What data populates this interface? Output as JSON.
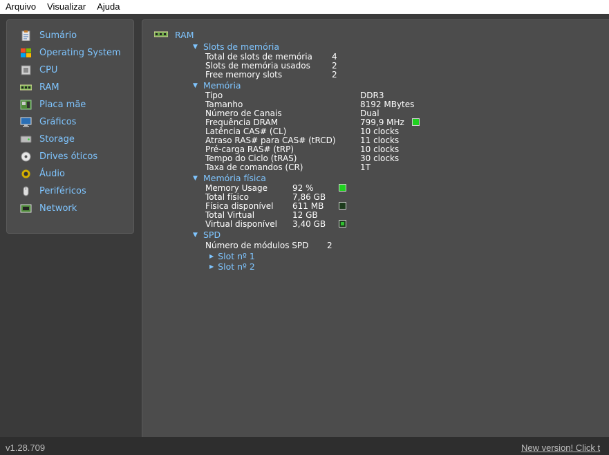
{
  "menu": [
    "Arquivo",
    "Visualizar",
    "Ajuda"
  ],
  "sidebar": {
    "items": [
      {
        "label": "Sumário",
        "icon": "summary-icon"
      },
      {
        "label": "Operating System",
        "icon": "windows-icon"
      },
      {
        "label": "CPU",
        "icon": "cpu-icon"
      },
      {
        "label": "RAM",
        "icon": "ram-icon"
      },
      {
        "label": "Placa mãe",
        "icon": "motherboard-icon"
      },
      {
        "label": "Gráficos",
        "icon": "monitor-icon"
      },
      {
        "label": "Storage",
        "icon": "hard-drive-icon"
      },
      {
        "label": "Drives óticos",
        "icon": "optical-disc-icon"
      },
      {
        "label": "Áudio",
        "icon": "speaker-icon"
      },
      {
        "label": "Periféricos",
        "icon": "mouse-icon"
      },
      {
        "label": "Network",
        "icon": "network-icon"
      }
    ]
  },
  "main": {
    "title": "RAM",
    "slots": {
      "header": "Slots de memória",
      "rows": [
        {
          "k": "Total de slots de memória",
          "v": "4"
        },
        {
          "k": "Slots de memória usados",
          "v": "2"
        },
        {
          "k": "Free memory slots",
          "v": "2"
        }
      ]
    },
    "memoria": {
      "header": "Memória",
      "rows": [
        {
          "k": "Tipo",
          "v": "DDR3"
        },
        {
          "k": "Tamanho",
          "v": "8192 MBytes"
        },
        {
          "k": "Número de Canais",
          "v": "Dual"
        },
        {
          "k": "Frequência DRAM",
          "v": "799,9 MHz"
        },
        {
          "k": "Latência CAS# (CL)",
          "v": "10 clocks"
        },
        {
          "k": "Atraso RAS# para CAS# (tRCD)",
          "v": "11 clocks"
        },
        {
          "k": "Pré-carga RAS# (tRP)",
          "v": "10 clocks"
        },
        {
          "k": "Tempo do Ciclo (tRAS)",
          "v": "30 clocks"
        },
        {
          "k": "Taxa de comandos (CR)",
          "v": "1T"
        }
      ]
    },
    "fisica": {
      "header": "Memória física",
      "rows": [
        {
          "k": "Memory Usage",
          "v": "92 %"
        },
        {
          "k": "Total físico",
          "v": "7,86 GB"
        },
        {
          "k": "Física disponível",
          "v": "611 MB"
        },
        {
          "k": "Total Virtual",
          "v": "12 GB"
        },
        {
          "k": "Virtual disponível",
          "v": "3,40 GB"
        }
      ]
    },
    "spd": {
      "header": "SPD",
      "rows": [
        {
          "k": "Número de módulos SPD",
          "v": "2"
        }
      ],
      "slots": [
        "Slot nº 1",
        "Slot nº 2"
      ]
    }
  },
  "status": {
    "version": "v1.28.709",
    "new_version": "New version! Click t"
  },
  "colors": {
    "accent": "#7fc5ff",
    "panel": "#4c4c4c",
    "background": "#3a3a3a",
    "indicator_green": "#1fd11f"
  }
}
